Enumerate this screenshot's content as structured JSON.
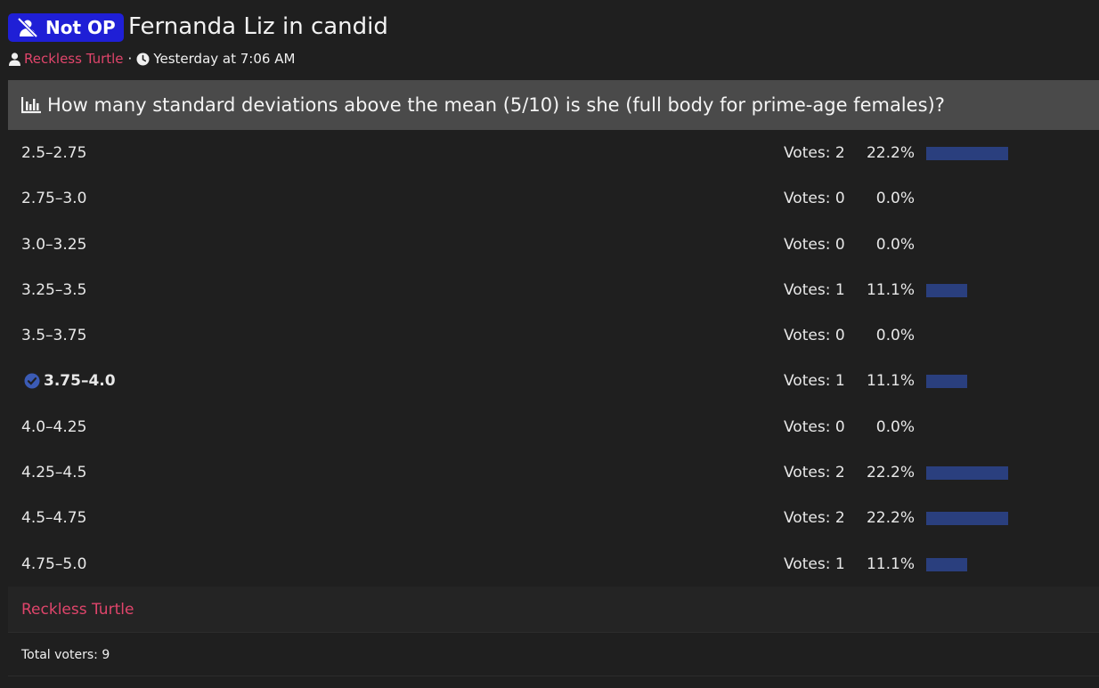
{
  "header": {
    "badge_label": "Not OP",
    "title": "Fernanda Liz in candid",
    "author": "Reckless Turtle",
    "separator": "·",
    "timestamp": "Yesterday at 7:06 AM"
  },
  "poll": {
    "question": "How many standard deviations above the mean (5/10) is she (full body for prime-age females)?",
    "options": [
      {
        "label": "2.5–2.75",
        "votes": "Votes: 2",
        "pct": "22.2%",
        "fraction": 0.222
      },
      {
        "label": "2.75–3.0",
        "votes": "Votes: 0",
        "pct": "0.0%",
        "fraction": 0
      },
      {
        "label": "3.0–3.25",
        "votes": "Votes: 0",
        "pct": "0.0%",
        "fraction": 0
      },
      {
        "label": "3.25–3.5",
        "votes": "Votes: 1",
        "pct": "11.1%",
        "fraction": 0.111
      },
      {
        "label": "3.5–3.75",
        "votes": "Votes: 0",
        "pct": "0.0%",
        "fraction": 0
      },
      {
        "label": "3.75–4.0",
        "votes": "Votes: 1",
        "pct": "11.1%",
        "fraction": 0.111,
        "chosen": true
      },
      {
        "label": "4.0–4.25",
        "votes": "Votes: 0",
        "pct": "0.0%",
        "fraction": 0
      },
      {
        "label": "4.25–4.5",
        "votes": "Votes: 2",
        "pct": "22.2%",
        "fraction": 0.222
      },
      {
        "label": "4.5–4.75",
        "votes": "Votes: 2",
        "pct": "22.2%",
        "fraction": 0.222
      },
      {
        "label": "4.75–5.0",
        "votes": "Votes: 1",
        "pct": "11.1%",
        "fraction": 0.111
      }
    ],
    "voter_name": "Reckless Turtle",
    "total_voters": "Total voters: 9"
  },
  "colors": {
    "badge_bg": "#1f1fd6",
    "author": "#e0456b",
    "bar": "#2a3f7e",
    "question_bg": "#4a4a4a"
  },
  "icons": {
    "badge": "user-slash-icon",
    "author": "user-icon",
    "time": "clock-icon",
    "question": "poll-chart-icon",
    "chosen": "check-circle-icon"
  }
}
